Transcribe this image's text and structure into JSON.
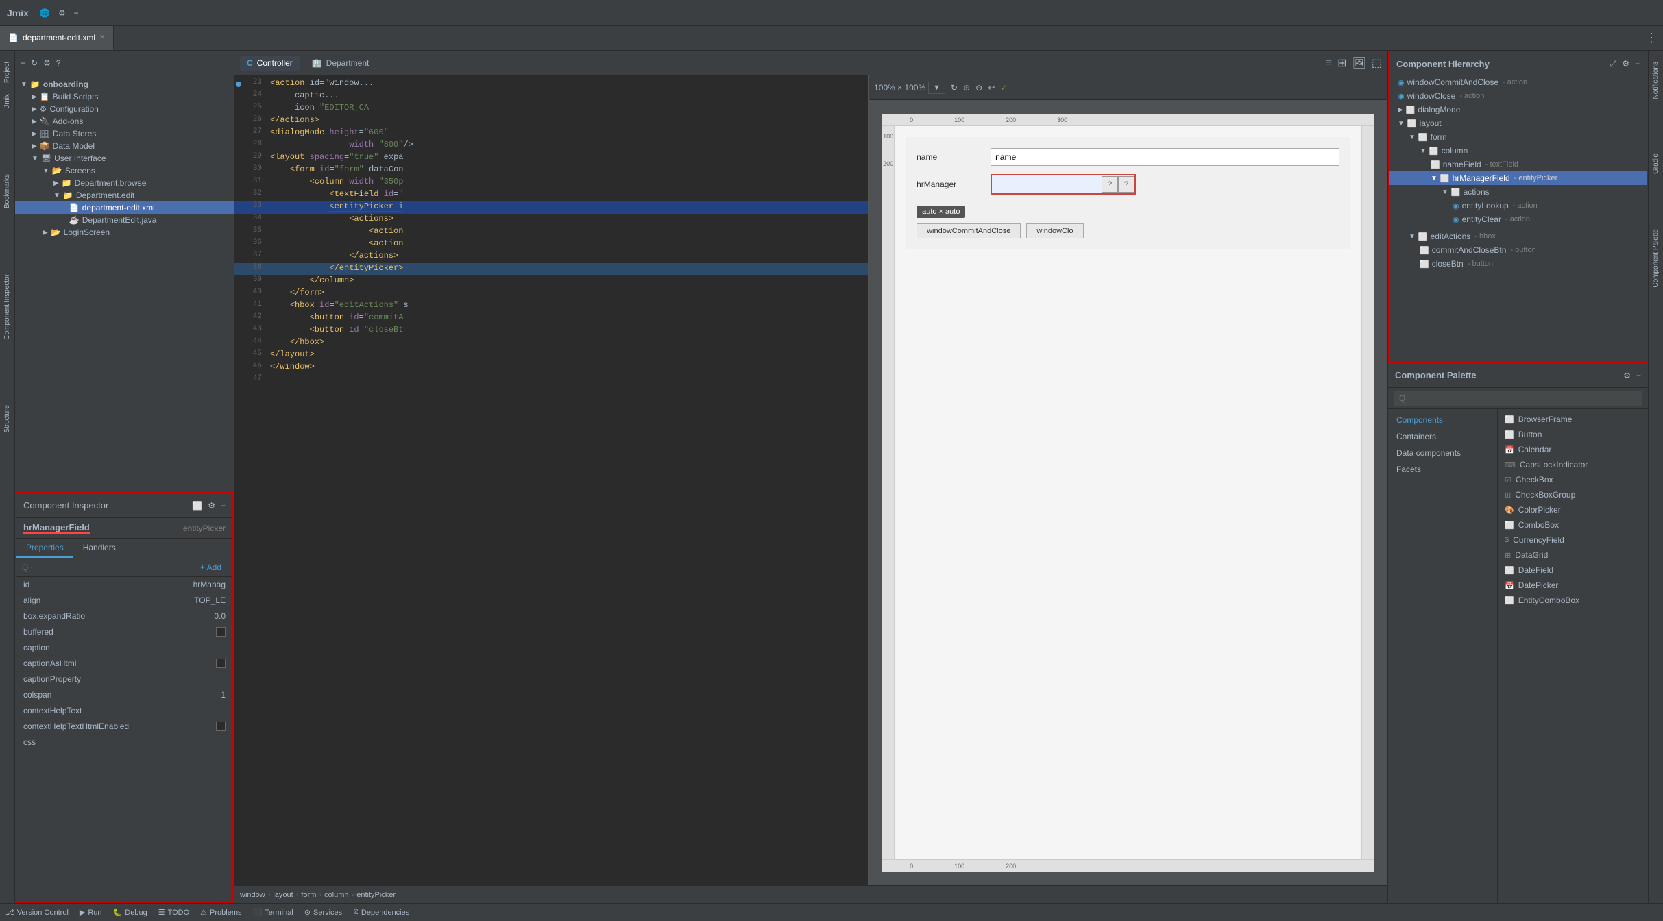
{
  "app": {
    "title": "Jmix",
    "tab_label": "department-edit.xml"
  },
  "titlebar": {
    "title": "Jmix",
    "icons": [
      "globe",
      "gear",
      "minus"
    ]
  },
  "tabs": [
    {
      "label": "department-edit.xml",
      "active": true,
      "icon": "xml"
    }
  ],
  "editor_tabs": [
    {
      "label": "Controller",
      "icon": "C",
      "active": false
    },
    {
      "label": "Department",
      "icon": "D",
      "active": false
    }
  ],
  "sidebar": {
    "root": "onboarding",
    "items": [
      {
        "label": "Build Scripts",
        "depth": 1,
        "icon": "script",
        "expandable": true
      },
      {
        "label": "Configuration",
        "depth": 1,
        "icon": "config",
        "expandable": true
      },
      {
        "label": "Add-ons",
        "depth": 1,
        "icon": "addon",
        "expandable": true
      },
      {
        "label": "Data Stores",
        "depth": 1,
        "icon": "store",
        "expandable": true
      },
      {
        "label": "Data Model",
        "depth": 1,
        "icon": "model",
        "expandable": true
      },
      {
        "label": "User Interface",
        "depth": 1,
        "icon": "ui",
        "expandable": true,
        "expanded": true
      },
      {
        "label": "Screens",
        "depth": 2,
        "icon": "screens",
        "expandable": true,
        "expanded": true
      },
      {
        "label": "Department.browse",
        "depth": 3,
        "icon": "browse",
        "expandable": true
      },
      {
        "label": "Department.edit",
        "depth": 3,
        "icon": "edit",
        "expandable": true,
        "expanded": true
      },
      {
        "label": "department-edit.xml",
        "depth": 4,
        "icon": "xml",
        "selected": true
      },
      {
        "label": "DepartmentEdit.java",
        "depth": 4,
        "icon": "java"
      },
      {
        "label": "LoginScreen",
        "depth": 2,
        "icon": "login",
        "expandable": true
      }
    ]
  },
  "component_inspector": {
    "title": "Component Inspector",
    "component_name": "hrManagerField",
    "component_name_underline": true,
    "component_type": "entityPicker",
    "tabs": [
      "Properties",
      "Handlers"
    ],
    "active_tab": "Properties",
    "search_placeholder": "Q~",
    "add_button": "+ Add",
    "properties": [
      {
        "name": "id",
        "value": "hrManag",
        "type": "text"
      },
      {
        "name": "align",
        "value": "TOP_LE",
        "type": "text"
      },
      {
        "name": "box.expandRatio",
        "value": "0.0",
        "type": "text"
      },
      {
        "name": "buffered",
        "value": "",
        "type": "checkbox"
      },
      {
        "name": "caption",
        "value": "",
        "type": "text"
      },
      {
        "name": "captionAsHtml",
        "value": "",
        "type": "checkbox"
      },
      {
        "name": "captionProperty",
        "value": "",
        "type": "text"
      },
      {
        "name": "colspan",
        "value": "1",
        "type": "text"
      },
      {
        "name": "contextHelpText",
        "value": "",
        "type": "text"
      },
      {
        "name": "contextHelpTextHtmlEnabled",
        "value": "",
        "type": "checkbox"
      },
      {
        "name": "css",
        "value": "",
        "type": "text"
      }
    ]
  },
  "component_hierarchy": {
    "title": "Component Hierarchy",
    "items": [
      {
        "label": "windowCommitAndClose",
        "type": "action",
        "depth": 0
      },
      {
        "label": "windowClose",
        "type": "action",
        "depth": 0
      },
      {
        "label": "dialogMode",
        "type": "",
        "depth": 0,
        "expandable": true,
        "expanded": false
      },
      {
        "label": "layout",
        "type": "",
        "depth": 0,
        "expandable": true,
        "expanded": true
      },
      {
        "label": "form",
        "type": "",
        "depth": 1,
        "expandable": true,
        "expanded": true
      },
      {
        "label": "column",
        "type": "",
        "depth": 2,
        "expandable": true,
        "expanded": true
      },
      {
        "label": "nameField",
        "type": "textField",
        "depth": 3
      },
      {
        "label": "hrManagerField",
        "type": "entityPicker",
        "depth": 3,
        "selected": true,
        "expandable": true,
        "expanded": true
      },
      {
        "label": "actions",
        "type": "",
        "depth": 4,
        "expandable": true,
        "expanded": true
      },
      {
        "label": "entityLookup",
        "type": "action",
        "depth": 5
      },
      {
        "label": "entityClear",
        "type": "action",
        "depth": 5
      },
      {
        "label": "editActions",
        "type": "hbox",
        "depth": 1,
        "expandable": true,
        "expanded": true,
        "separator_before": true
      },
      {
        "label": "commitAndCloseBtn",
        "type": "button",
        "depth": 2
      },
      {
        "label": "closeBtn",
        "type": "button",
        "depth": 2
      }
    ]
  },
  "component_palette": {
    "title": "Component Palette",
    "search_placeholder": "Q",
    "categories": [
      "Components",
      "Containers",
      "Data components",
      "Facets"
    ],
    "active_category": "Components",
    "items": [
      {
        "label": "BrowserFrame",
        "icon": "frame"
      },
      {
        "label": "Button",
        "icon": "btn"
      },
      {
        "label": "Calendar",
        "icon": "cal"
      },
      {
        "label": "CapsLockIndicator",
        "icon": "caps"
      },
      {
        "label": "CheckBox",
        "icon": "check"
      },
      {
        "label": "CheckBoxGroup",
        "icon": "checkgroup"
      },
      {
        "label": "ColorPicker",
        "icon": "color"
      },
      {
        "label": "ComboBox",
        "icon": "combo"
      },
      {
        "label": "CurrencyField",
        "icon": "currency"
      },
      {
        "label": "DataGrid",
        "icon": "grid"
      },
      {
        "label": "DateField",
        "icon": "date"
      },
      {
        "label": "DatePicker",
        "icon": "datepick"
      },
      {
        "label": "EntityComboBox",
        "icon": "entitycombo"
      }
    ]
  },
  "code_lines": [
    {
      "num": 23,
      "content": "    <action id=\"window...",
      "highlight": false,
      "indicator": true
    },
    {
      "num": 24,
      "content": "         captic...",
      "highlight": false
    },
    {
      "num": 25,
      "content": "         icon=\"EDITOR_CA",
      "highlight": false
    },
    {
      "num": 26,
      "content": "    </actions>",
      "highlight": false
    },
    {
      "num": 27,
      "content": "    <dialogMode height=\"600\"",
      "highlight": false
    },
    {
      "num": 28,
      "content": "                width=\"800\"/>",
      "highlight": false
    },
    {
      "num": 29,
      "content": "    <layout spacing=\"true\" expa",
      "highlight": false
    },
    {
      "num": 30,
      "content": "        <form id=\"form\" dataCon",
      "highlight": false
    },
    {
      "num": 31,
      "content": "            <column width=\"350p",
      "highlight": false
    },
    {
      "num": 32,
      "content": "                <textField id=\"",
      "highlight": false
    },
    {
      "num": 33,
      "content": "                <entityPicker i",
      "highlight": true,
      "selected": true,
      "red_underline": true
    },
    {
      "num": 34,
      "content": "                    <actions>",
      "highlight": false
    },
    {
      "num": 35,
      "content": "                        <action",
      "highlight": false
    },
    {
      "num": 36,
      "content": "                        <action",
      "highlight": false
    },
    {
      "num": 37,
      "content": "                    </actions>",
      "highlight": false
    },
    {
      "num": 38,
      "content": "                </entityPicker>",
      "highlight": false,
      "marker": true
    },
    {
      "num": 39,
      "content": "            </column>",
      "highlight": false
    },
    {
      "num": 40,
      "content": "        </form>",
      "highlight": false
    },
    {
      "num": 41,
      "content": "        <hbox id=\"editActions\" s",
      "highlight": false
    },
    {
      "num": 42,
      "content": "            <button id=\"commitA",
      "highlight": false
    },
    {
      "num": 43,
      "content": "            <button id=\"closeBt",
      "highlight": false
    },
    {
      "num": 44,
      "content": "        </hbox>",
      "highlight": false
    },
    {
      "num": 45,
      "content": "    </layout>",
      "highlight": false
    },
    {
      "num": 46,
      "content": "</window>",
      "highlight": false
    },
    {
      "num": 47,
      "content": "",
      "highlight": false
    }
  ],
  "preview": {
    "zoom": "100% × 100%",
    "form_fields": [
      {
        "label": "name",
        "value": "name",
        "type": "text"
      },
      {
        "label": "hrManager",
        "value": "",
        "type": "entity_picker",
        "highlighted": true
      }
    ],
    "tooltip": "auto × auto",
    "action_buttons": [
      "windowCommitAndClose",
      "windowClo"
    ]
  },
  "breadcrumb": {
    "items": [
      "window",
      "layout",
      "form",
      "column",
      "entityPicker"
    ]
  },
  "status_bar": {
    "items": [
      {
        "icon": "git",
        "label": "Version Control"
      },
      {
        "icon": "run",
        "label": "Run"
      },
      {
        "icon": "debug",
        "label": "Debug"
      },
      {
        "icon": "todo",
        "label": "TODO"
      },
      {
        "icon": "problem",
        "label": "Problems"
      },
      {
        "icon": "terminal",
        "label": "Terminal"
      },
      {
        "icon": "service",
        "label": "Services"
      },
      {
        "icon": "dep",
        "label": "Dependencies"
      }
    ]
  },
  "vertical_tabs_right": [
    "Notifications",
    "Gradle",
    "Component Palette"
  ],
  "vertical_tabs_left": [
    "Project",
    "Jmix",
    "Bookmarks",
    "Component Inspector",
    "Structure"
  ]
}
